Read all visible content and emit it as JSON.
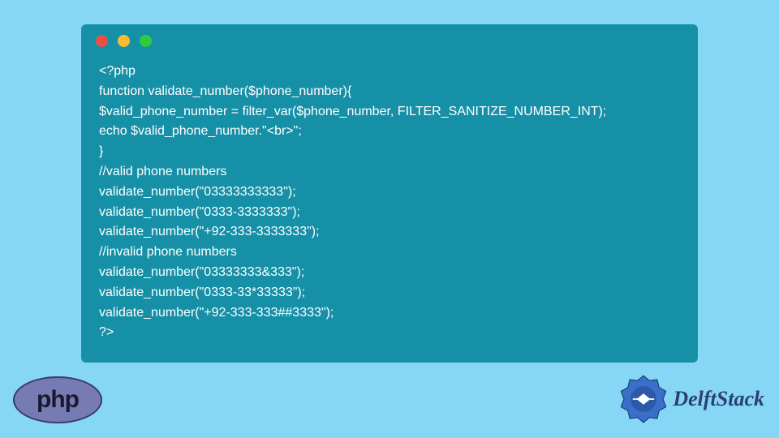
{
  "window": {
    "dots": [
      "red",
      "yellow",
      "green"
    ]
  },
  "code_lines": [
    "<?php",
    "function validate_number($phone_number){",
    "$valid_phone_number = filter_var($phone_number, FILTER_SANITIZE_NUMBER_INT);",
    "echo $valid_phone_number.\"<br>\";",
    "}",
    "//valid phone numbers",
    "validate_number(\"03333333333\");",
    "validate_number(\"0333-3333333\");",
    "validate_number(\"+92-333-3333333\");",
    "//invalid phone numbers",
    "validate_number(\"03333333&333\");",
    "validate_number(\"0333-33*33333\");",
    "validate_number(\"+92-333-333##3333\");",
    "?>"
  ],
  "logos": {
    "php": "php",
    "delftstack": "DelftStack"
  }
}
